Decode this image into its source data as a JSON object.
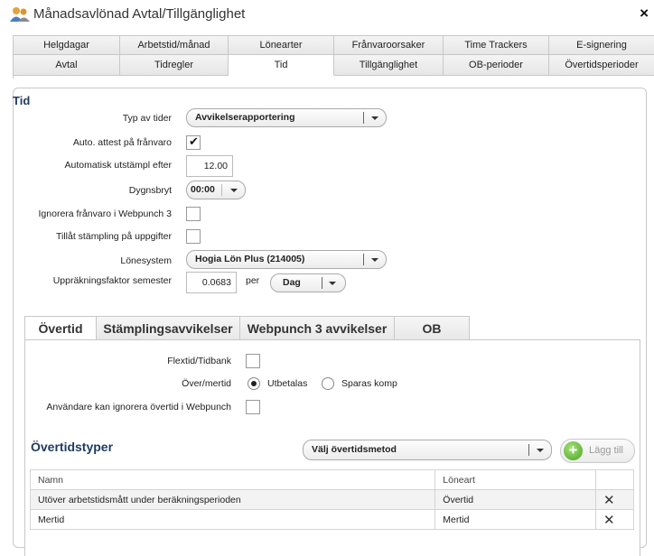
{
  "window": {
    "title": "Månadsavlönad Avtal/Tillgänglighet",
    "close": "×",
    "icon": "users-icon"
  },
  "tabs_row1": [
    "Helgdagar",
    "Arbetstid/månad",
    "Lönearter",
    "Frånvaroorsaker",
    "Time Trackers",
    "E-signering"
  ],
  "tabs_row2": [
    "Avtal",
    "Tidregler",
    "Tid",
    "Tillgänglighet",
    "OB-perioder",
    "Övertidsperioder"
  ],
  "active_tab": "Tid",
  "tid": {
    "title": "Tid",
    "typ_av_tider": {
      "label": "Typ av tider",
      "value": "Avvikelserapportering"
    },
    "auto_attest": {
      "label": "Auto. attest på frånvaro",
      "checked": true
    },
    "automatisk_utstampl": {
      "label": "Automatisk utstämpl efter",
      "value": "12.00"
    },
    "dygnsbryt": {
      "label": "Dygnsbryt",
      "value": "00:00"
    },
    "ignorera_franvaro": {
      "label": "Ignorera frånvaro i Webpunch 3",
      "checked": false
    },
    "tillat_stampling": {
      "label": "Tillåt stämpling på uppgifter",
      "checked": false
    },
    "lonesystem": {
      "label": "Lönesystem",
      "value": "Hogia Lön Plus (214005)"
    },
    "upprakningsfaktor": {
      "label": "Uppräkningsfaktor semester",
      "value": "0.0683",
      "per": "per",
      "unit": "Dag"
    }
  },
  "inner_tabs": [
    "Övertid",
    "Stämplingsavvikelser",
    "Webpunch 3 avvikelser",
    "OB"
  ],
  "overtid": {
    "flextid": {
      "label": "Flextid/Tidbank",
      "checked": false
    },
    "over_mertid": {
      "label": "Över/mertid",
      "option1": "Utbetalas",
      "option2": "Sparas komp",
      "selected": "Utbetalas"
    },
    "anvandare_ignorera": {
      "label": "Användare kan ignorera övertid i Webpunch",
      "checked": false
    },
    "section_title": "Övertidstyper",
    "metod_select": "Välj övertidsmetod",
    "add_button": "Lägg till",
    "table": {
      "headers": [
        "Namn",
        "Löneart"
      ],
      "rows": [
        {
          "namn": "Utöver arbetstidsmått under beräkningsperioden",
          "loneart": "Övertid"
        },
        {
          "namn": "Mertid",
          "loneart": "Mertid"
        }
      ]
    }
  }
}
